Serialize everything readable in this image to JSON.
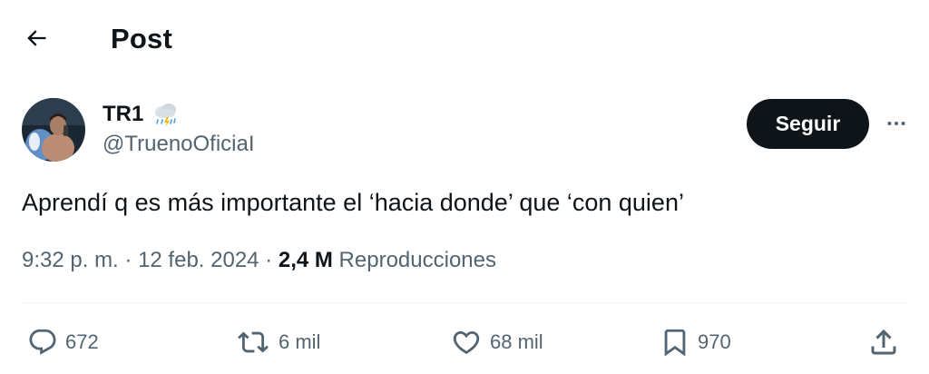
{
  "header": {
    "title": "Post",
    "back_icon": "arrow-left-icon"
  },
  "author": {
    "display_name": "TR1",
    "name_badge_icon": "storm-cloud-emoji-icon",
    "handle": "@TruenoOficiaI",
    "avatar_icon": "profile-photo"
  },
  "follow_label": "Seguir",
  "more_icon": "more-horizontal-icon",
  "post": {
    "text": "Aprendí q es más importante el ‘hacia donde’ que ‘con quien’",
    "time": "9:32 p. m.",
    "sep1": " · ",
    "date": "12 feb. 2024",
    "sep2": " · ",
    "views": "2,4 M",
    "views_label": " Reproducciones"
  },
  "actions": {
    "replies": {
      "icon": "reply-icon",
      "count": "672"
    },
    "reposts": {
      "icon": "repost-icon",
      "count": "6 mil"
    },
    "likes": {
      "icon": "heart-icon",
      "count": "68 mil"
    },
    "bookmarks": {
      "icon": "bookmark-icon",
      "count": "970"
    },
    "share": {
      "icon": "share-icon"
    }
  },
  "colors": {
    "text_primary": "#0f1419",
    "text_secondary": "#536471",
    "follow_bg": "#0f1419",
    "divider": "#eff3f4"
  }
}
